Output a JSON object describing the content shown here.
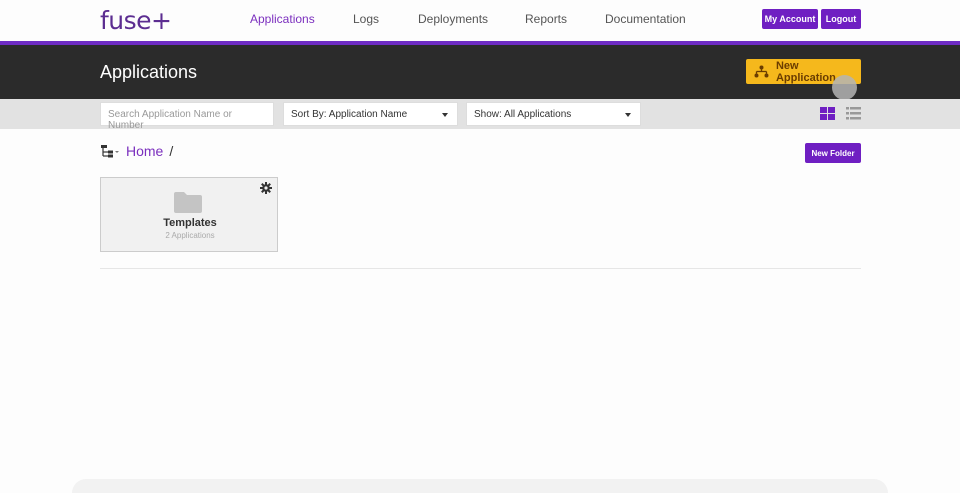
{
  "brand": {
    "logo_text": "fuse+",
    "accent": "#6f1fc2",
    "cta_color": "#f5b81c",
    "header_bg": "#2b2b2b"
  },
  "nav": {
    "links": [
      "Applications",
      "Logs",
      "Deployments",
      "Reports",
      "Documentation"
    ],
    "active": "Applications",
    "my_account": "My Account",
    "logout": "Logout"
  },
  "header": {
    "title": "Applications",
    "new_app_label": "New Application",
    "new_app_icon": "hierarchy-icon"
  },
  "filters": {
    "search_placeholder": "Search Application Name or Number",
    "sort_label": "Sort By: Application Name",
    "show_label": "Show: All Applications",
    "view_modes": [
      "grid-view-icon",
      "list-view-icon"
    ],
    "active_view": "grid"
  },
  "breadcrumb": {
    "home": "Home",
    "separator": "/"
  },
  "new_folder_label": "New Folder",
  "folders": [
    {
      "name": "Templates",
      "count": "2 Applications"
    }
  ]
}
